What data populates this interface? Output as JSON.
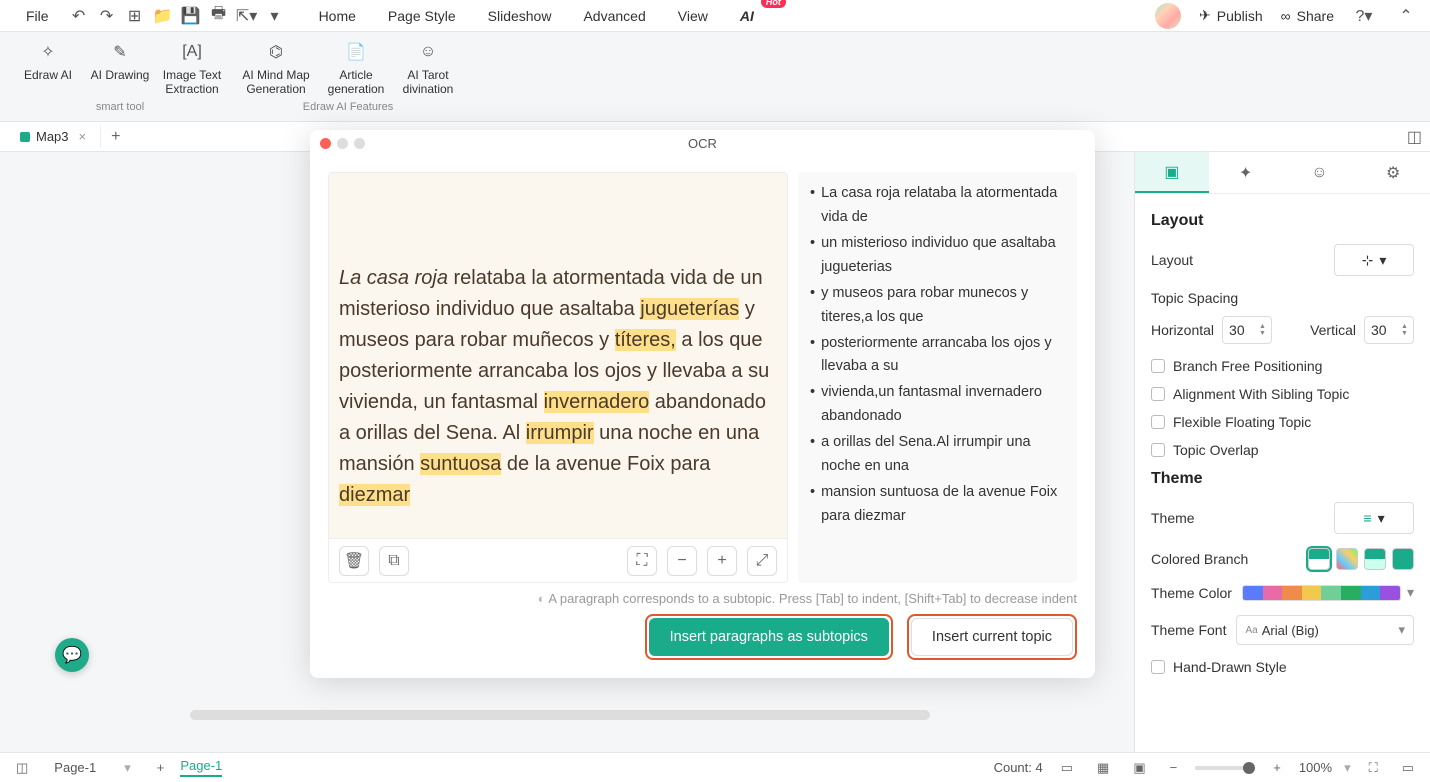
{
  "topMenu": {
    "file": "File",
    "home": "Home",
    "pageStyle": "Page Style",
    "slideshow": "Slideshow",
    "advanced": "Advanced",
    "view": "View",
    "ai": "AI",
    "hot": "Hot",
    "publish": "Publish",
    "share": "Share"
  },
  "ribbon": {
    "group1": {
      "edrawAI": "Edraw AI",
      "aiDrawing": "AI Drawing",
      "imageText": "Image Text Extraction",
      "caption": "smart tool"
    },
    "group2": {
      "mindMap": "AI Mind Map Generation",
      "article": "Article generation",
      "tarot": "AI Tarot divination",
      "caption": "Edraw AI Features"
    }
  },
  "tab": {
    "name": "Map3"
  },
  "ocr": {
    "title": "OCR",
    "paragraph_prefix_italic": "La casa roja",
    "paragraph_rest": " relataba la atormentada vida de un misterioso individuo que asaltaba ",
    "hl1": "jugueterías",
    "p2": " y museos para robar muñecos y ",
    "hl2": "títeres,",
    "p3": " a los que posteriormente arrancaba los ojos y llevaba a su vivienda, un fantasmal ",
    "hl3": "invernadero",
    "p4": " abandonado a orillas del Sena. Al ",
    "hl4": "irrumpir",
    "p5": " una noche en una mansión ",
    "hl5": "suntuosa",
    "p6": " de la avenue Foix para ",
    "hl6": "diezmar",
    "bullets": [
      "La casa roja relataba la atormentada vida de",
      "un misterioso individuo que asaltaba jugueterias",
      "y museos para robar munecos y titeres,a los que",
      "posteriormente arrancaba los ojos y llevaba a su",
      "vivienda,un fantasmal invernadero abandonado",
      "a orillas del Sena.Al irrumpir una noche en una",
      "mansion suntuosa de la avenue Foix para diezmar"
    ],
    "hint": "A paragraph corresponds to a subtopic. Press [Tab] to indent, [Shift+Tab] to decrease indent",
    "btnPrimary": "Insert paragraphs as subtopics",
    "btnSecondary": "Insert current topic"
  },
  "rightPanel": {
    "layout": "Layout",
    "layoutLabel": "Layout",
    "topicSpacing": "Topic Spacing",
    "horizontal": "Horizontal",
    "horizontalVal": "30",
    "vertical": "Vertical",
    "verticalVal": "30",
    "branchFree": "Branch Free Positioning",
    "alignment": "Alignment With Sibling Topic",
    "flexible": "Flexible Floating Topic",
    "overlap": "Topic Overlap",
    "theme": "Theme",
    "themeLabel": "Theme",
    "coloredBranch": "Colored Branch",
    "themeColor": "Theme Color",
    "themeFont": "Theme Font",
    "themeFontVal": "Arial (Big)",
    "handDrawn": "Hand-Drawn Style"
  },
  "status": {
    "pageSelector": "Page-1",
    "pageActive": "Page-1",
    "count": "Count: 4",
    "zoom": "100%"
  }
}
